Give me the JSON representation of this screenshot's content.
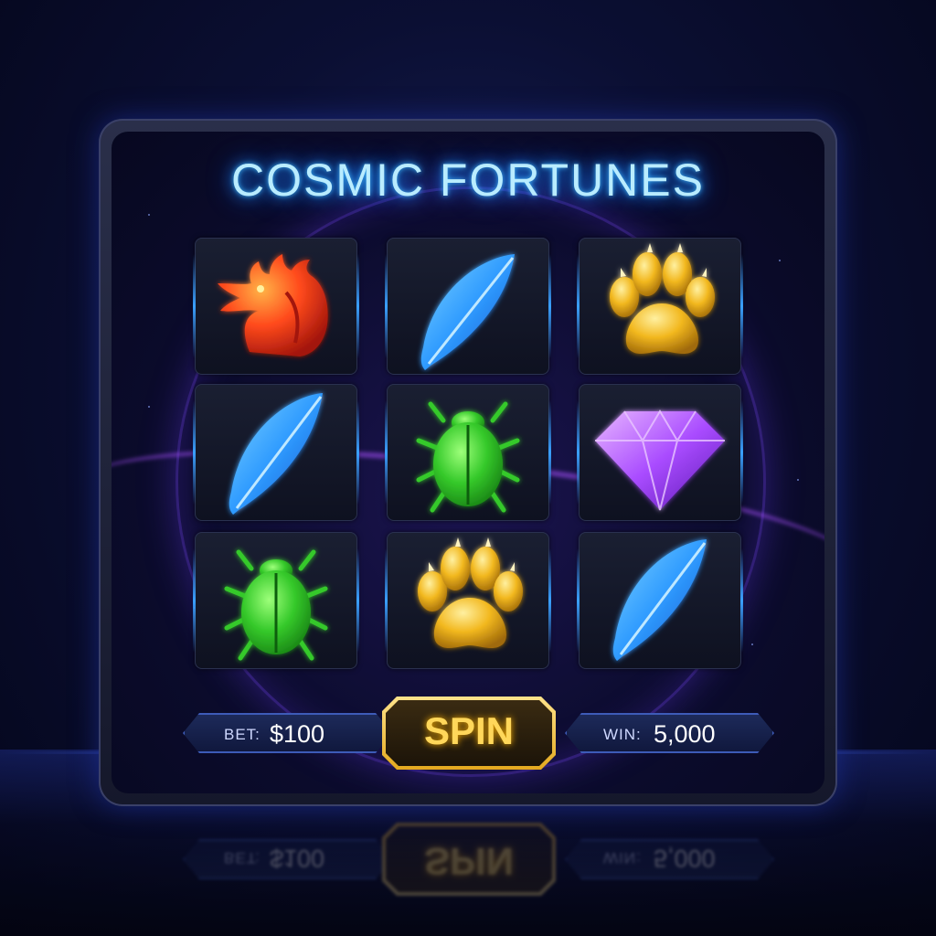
{
  "title": "COSMIC FORTUNES",
  "reels": [
    [
      "dragon-icon",
      "feather-icon",
      "paw-icon"
    ],
    [
      "feather-icon",
      "beetle-icon",
      "diamond-icon"
    ],
    [
      "beetle-icon",
      "paw-icon",
      "feather-icon"
    ]
  ],
  "controls": {
    "bet_label": "BET:",
    "bet_value": "$100",
    "spin_label": "SPIN",
    "win_label": "WIN:",
    "win_value": "5,000"
  },
  "colors": {
    "title_glow": "#1e90ff",
    "spin_gold": "#ffd75a",
    "dragon": "#ff4a1c",
    "feather": "#2f9bff",
    "paw": "#f2b81f",
    "beetle": "#35c92a",
    "diamond": "#a94cff"
  }
}
